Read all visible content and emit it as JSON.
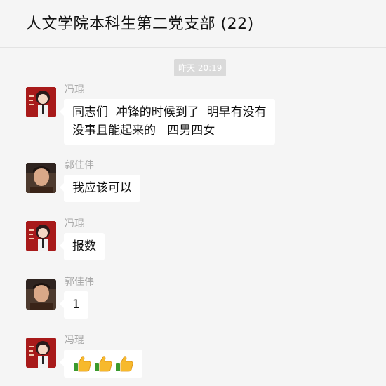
{
  "window": {
    "title": "人文学院本科生第二党支部 (22)",
    "controls": [
      "pin-icon",
      "minimize-icon",
      "maximize-icon"
    ]
  },
  "chat": {
    "timestamp": "昨天 20:19",
    "messages": [
      {
        "sender": "冯琨",
        "avatar": "cartoon-girl-red-avatar",
        "lines": [
          "同志们  冲锋的时候到了  明早有没有",
          "没事且能起来的   四男四女"
        ]
      },
      {
        "sender": "郭佳伟",
        "avatar": "man-photo-avatar",
        "lines": [
          "我应该可以"
        ]
      },
      {
        "sender": "冯琨",
        "avatar": "cartoon-girl-red-avatar",
        "lines": [
          "报数"
        ]
      },
      {
        "sender": "郭佳伟",
        "avatar": "man-photo-avatar",
        "lines": [
          "1"
        ]
      },
      {
        "sender": "冯琨",
        "avatar": "cartoon-girl-red-avatar",
        "emoji": [
          "thumbs-up-icon",
          "thumbs-up-icon",
          "thumbs-up-icon"
        ]
      }
    ]
  },
  "colors": {
    "background": "#f5f5f5",
    "bubble": "#ffffff",
    "sender_name": "#a8a8a8",
    "timestamp_bg": "#dadada"
  }
}
